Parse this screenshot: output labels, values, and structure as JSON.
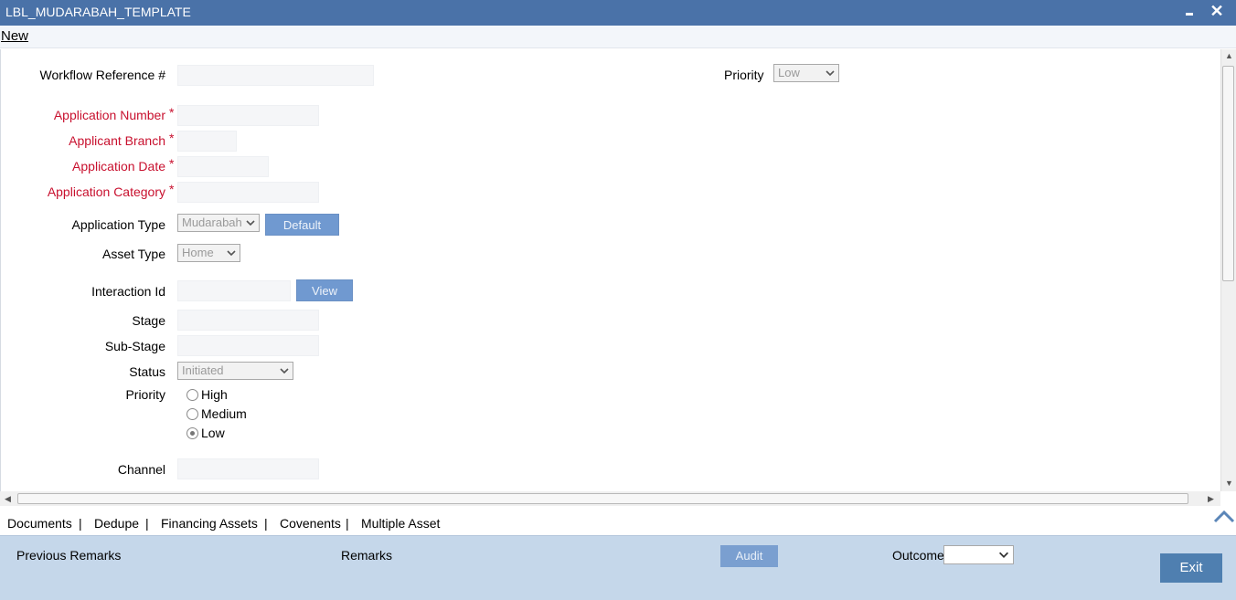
{
  "window": {
    "title": "LBL_MUDARABAH_TEMPLATE",
    "new_label": "New"
  },
  "form": {
    "workflow_ref_label": "Workflow Reference #",
    "workflow_ref_value": "",
    "priority_top_label": "Priority",
    "priority_top_value": "Low",
    "application_number_label": "Application Number",
    "applicant_branch_label": "Applicant Branch",
    "application_date_label": "Application Date",
    "application_category_label": "Application Category",
    "application_type_label": "Application Type",
    "application_type_value": "Mudarabah",
    "default_button": "Default",
    "asset_type_label": "Asset Type",
    "asset_type_value": "Home",
    "interaction_id_label": "Interaction Id",
    "view_button": "View",
    "stage_label": "Stage",
    "sub_stage_label": "Sub-Stage",
    "status_label": "Status",
    "status_value": "Initiated",
    "priority_label": "Priority",
    "priority_options": [
      "High",
      "Medium",
      "Low"
    ],
    "priority_selected": "Low",
    "channel_label": "Channel",
    "required_mark": "*"
  },
  "tabs": [
    {
      "label": "Documents"
    },
    {
      "label": "Dedupe"
    },
    {
      "label": "Financing Assets"
    },
    {
      "label": "Covenents"
    },
    {
      "label": "Multiple Asset"
    }
  ],
  "tab_separator": "|",
  "footer": {
    "previous_remarks": "Previous Remarks",
    "remarks": "Remarks",
    "audit": "Audit",
    "outcome_label": "Outcome",
    "outcome_value": "",
    "exit": "Exit"
  },
  "colors": {
    "titlebar": "#4a72a8",
    "required": "#c8102e",
    "footer": "#c5d7ea",
    "button": "#7099d0"
  }
}
